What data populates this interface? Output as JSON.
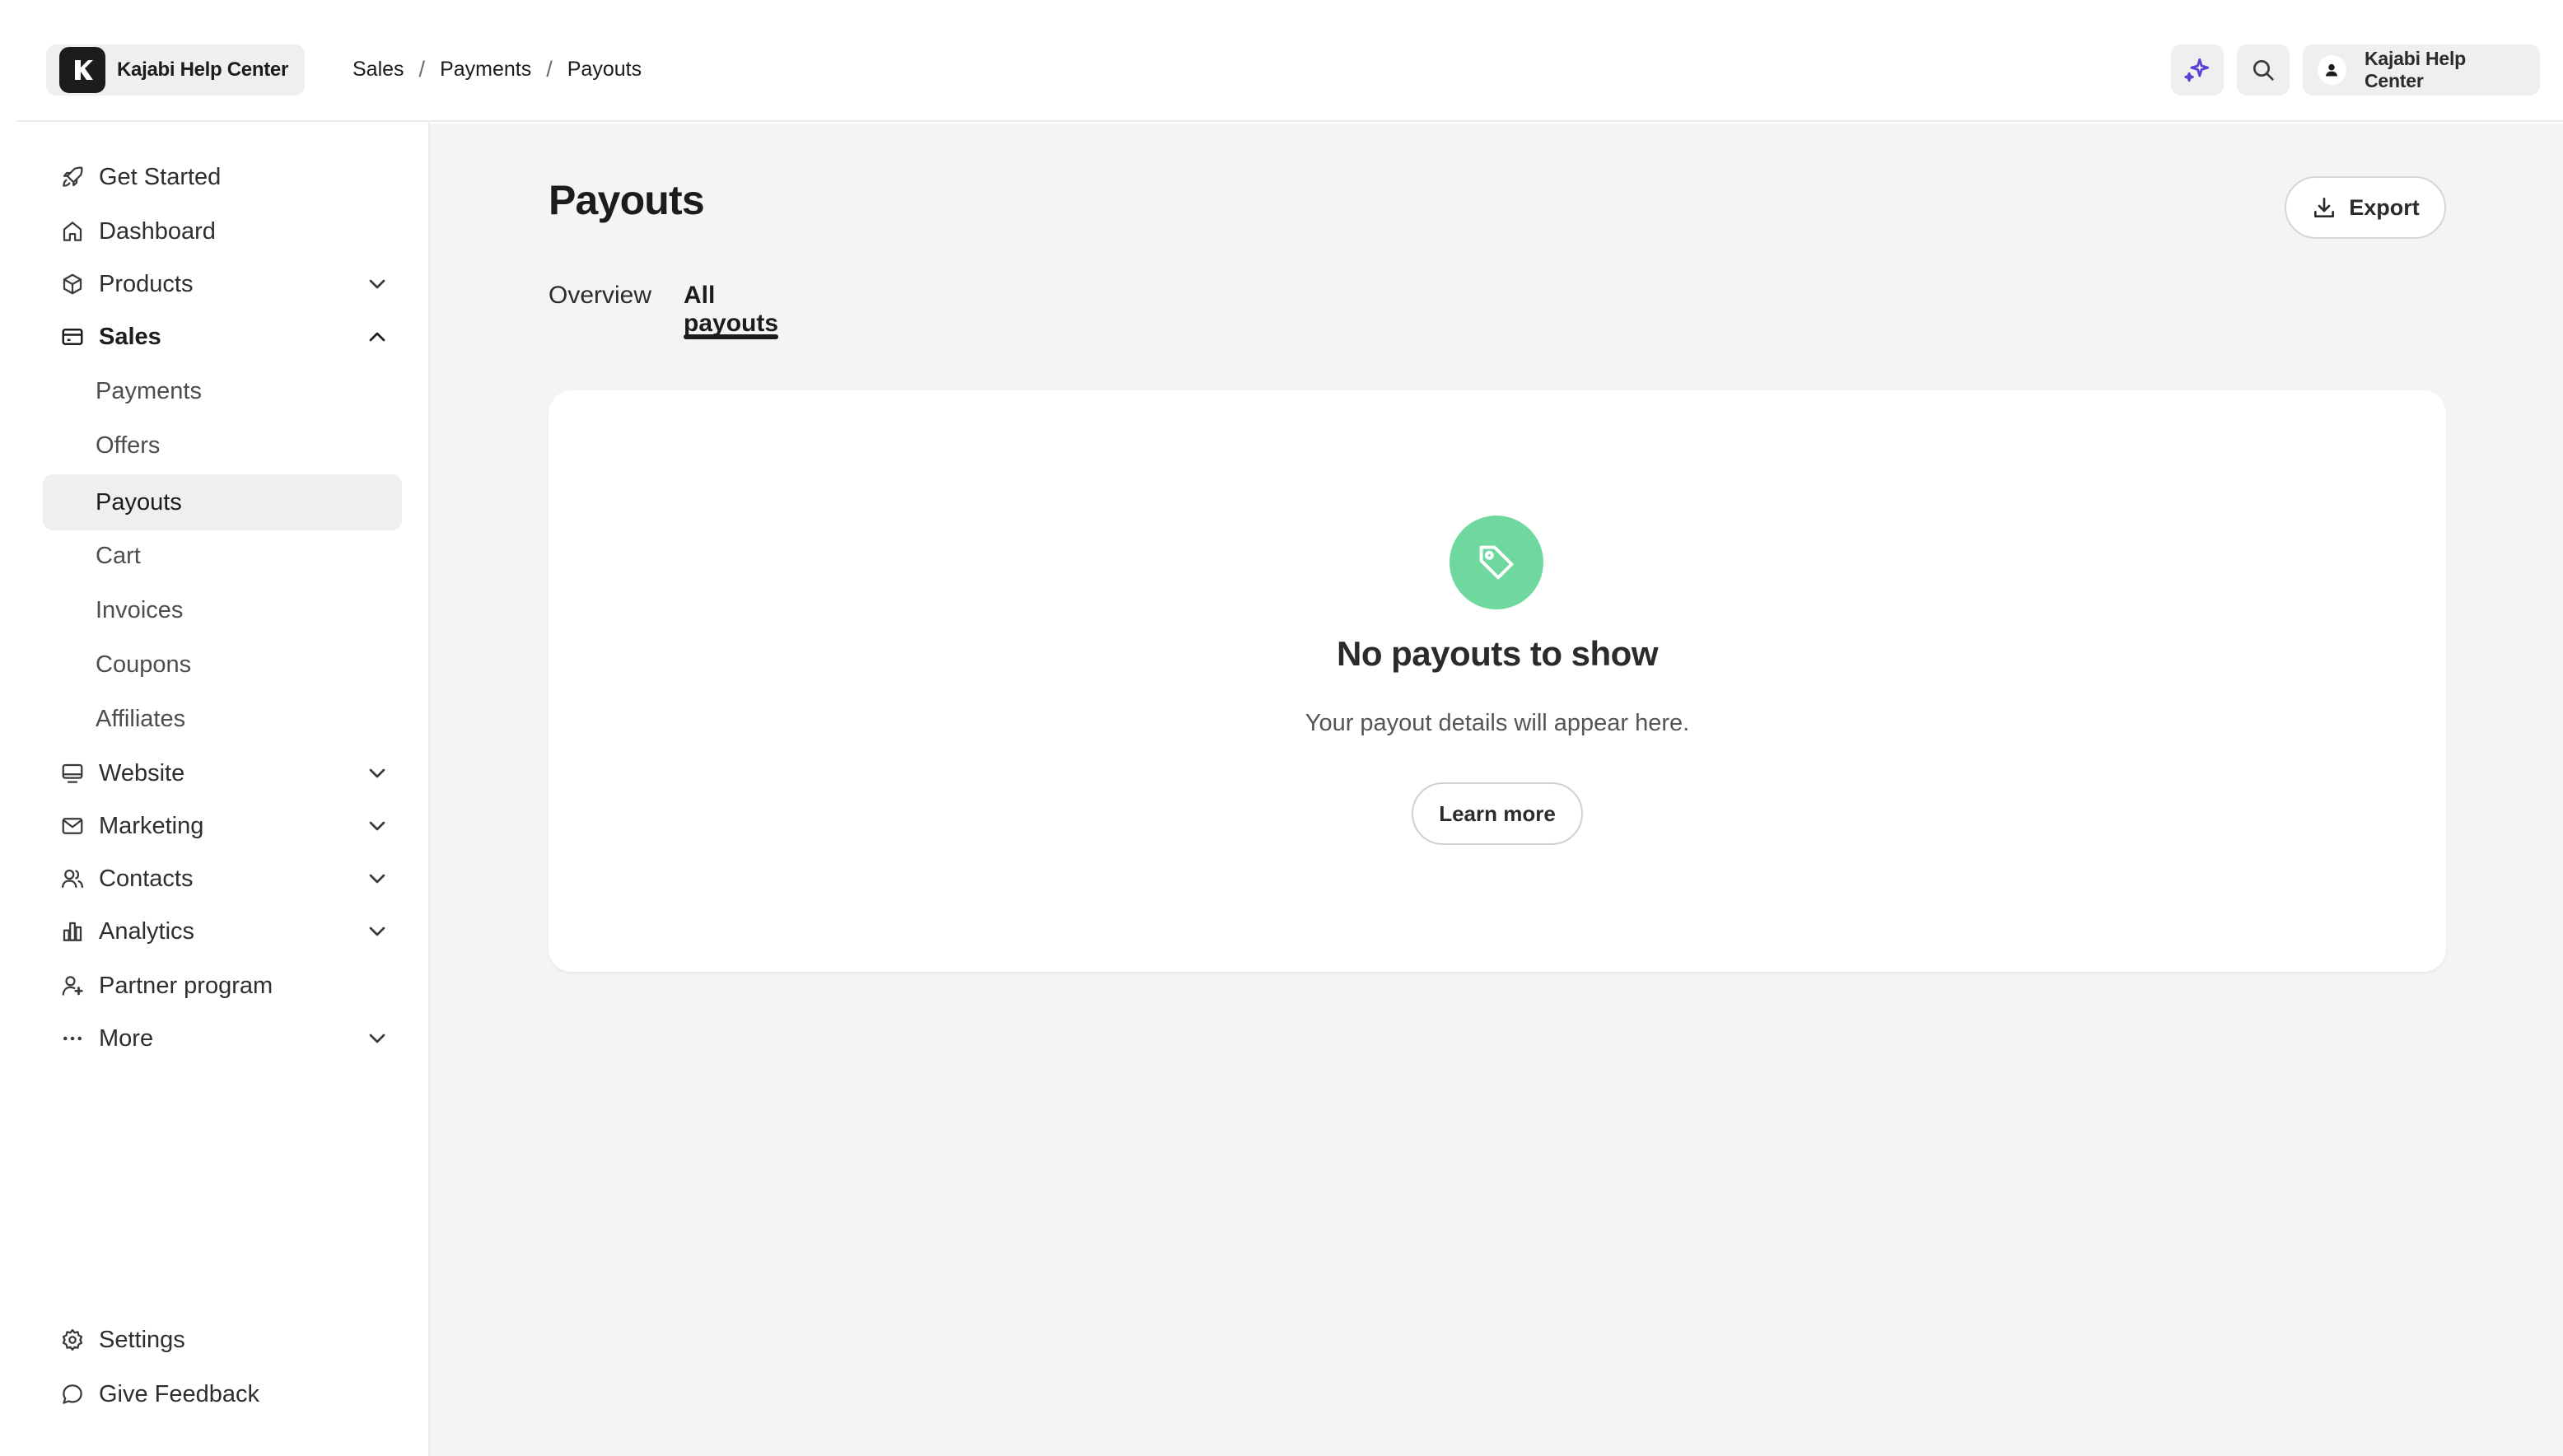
{
  "header": {
    "brand_name": "Kajabi Help Center",
    "breadcrumb": [
      "Sales",
      "Payments",
      "Payouts"
    ],
    "breadcrumb_separator": "/",
    "account_name": "Kajabi Help Center",
    "ai_icon_color": "#5b3fd6"
  },
  "sidebar": {
    "items": [
      {
        "label": "Get Started",
        "icon": "rocket-icon"
      },
      {
        "label": "Dashboard",
        "icon": "home-icon"
      },
      {
        "label": "Products",
        "icon": "box-icon",
        "expanded": false
      },
      {
        "label": "Sales",
        "icon": "credit-card-icon",
        "expanded": true
      },
      {
        "label": "Website",
        "icon": "monitor-icon",
        "expanded": false
      },
      {
        "label": "Marketing",
        "icon": "mail-icon",
        "expanded": false
      },
      {
        "label": "Contacts",
        "icon": "users-icon",
        "expanded": false
      },
      {
        "label": "Analytics",
        "icon": "bar-chart-icon",
        "expanded": false
      },
      {
        "label": "Partner program",
        "icon": "partner-icon"
      },
      {
        "label": "More",
        "icon": "ellipsis-icon",
        "expanded": false
      }
    ],
    "sales_subitems": [
      "Payments",
      "Offers",
      "Payouts",
      "Cart",
      "Invoices",
      "Coupons",
      "Affiliates"
    ],
    "active_subitem": "Payouts",
    "footer": [
      {
        "label": "Settings",
        "icon": "gear-icon"
      },
      {
        "label": "Give Feedback",
        "icon": "chat-bubble-icon"
      }
    ]
  },
  "main": {
    "title": "Payouts",
    "export_label": "Export",
    "tabs": [
      {
        "label": "Overview",
        "active": false
      },
      {
        "label": "All payouts",
        "active": true
      }
    ],
    "empty_state": {
      "icon": "tag-icon",
      "icon_bg": "#6fd89e",
      "title": "No payouts to show",
      "description": "Your payout details will appear here.",
      "button_label": "Learn more"
    }
  }
}
